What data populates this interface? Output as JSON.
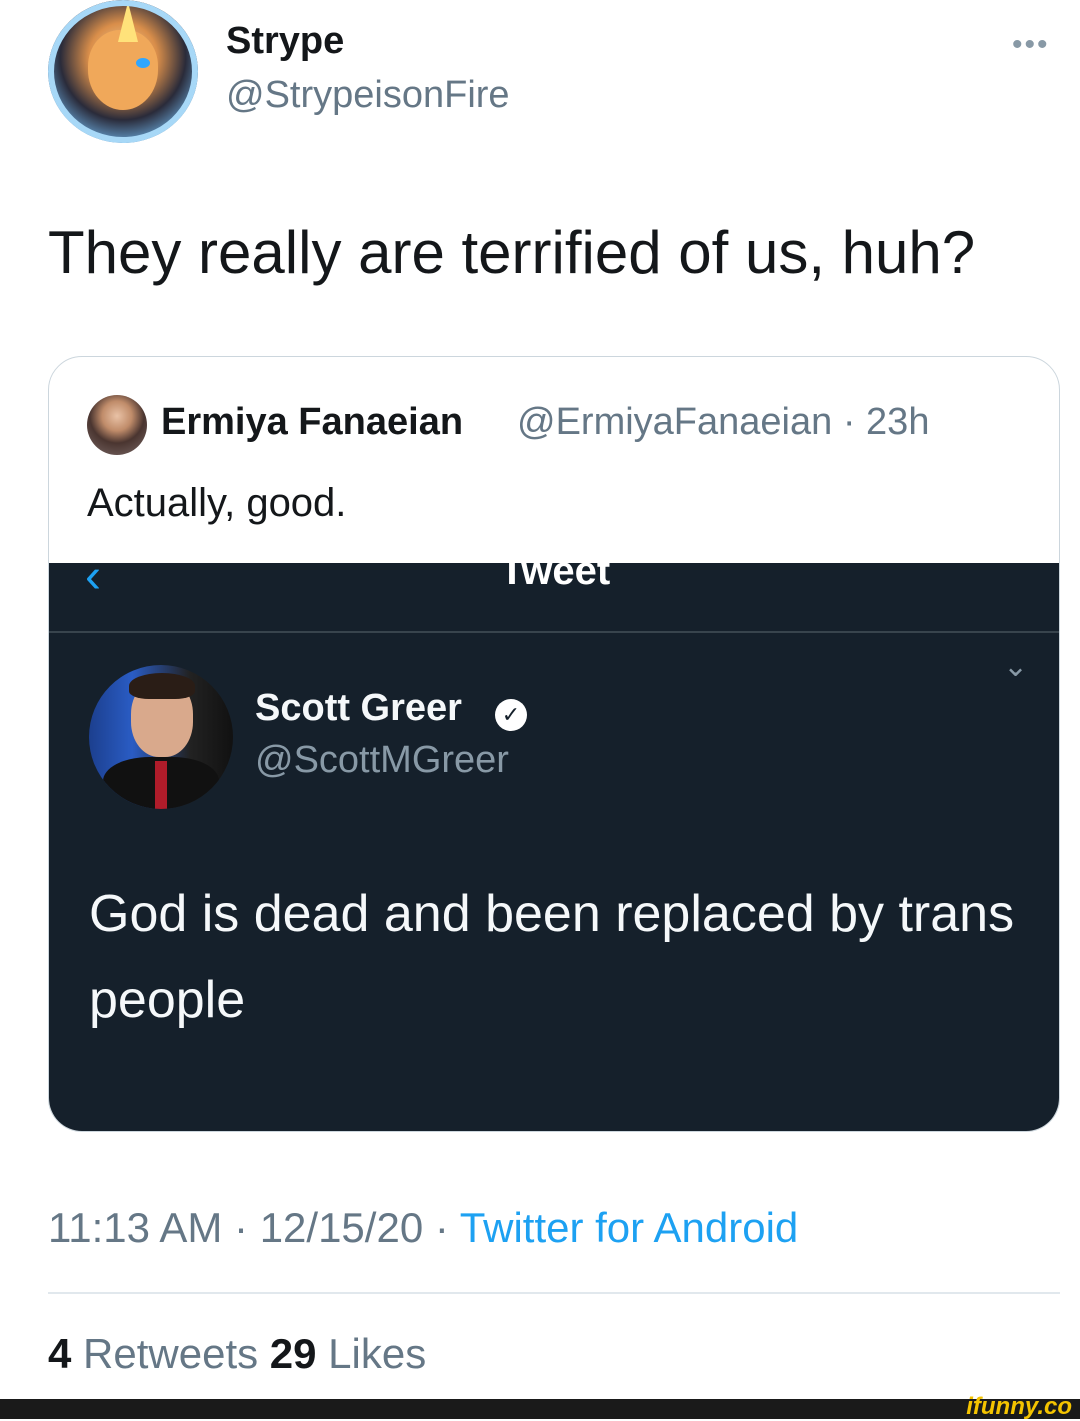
{
  "tweet": {
    "display_name": "Strype",
    "handle": "@StrypeisonFire",
    "text": "They really are terrified of us, huh?",
    "time": "11:13 AM",
    "date": "12/15/20",
    "source": "Twitter for Android",
    "separator": "·",
    "retweets_count": "4",
    "retweets_label": "Retweets",
    "likes_count": "29",
    "likes_label": "Likes",
    "more_icon": "more-options-icon"
  },
  "quoted": {
    "display_name": "Ermiya Fanaeian",
    "handle": "@ErmiyaFanaeian",
    "time": "23h",
    "separator": "·",
    "text": "Actually, good."
  },
  "embedded_screenshot": {
    "header_title": "Tweet",
    "back_icon": "back-chevron-icon",
    "expand_icon": "chevron-down-icon",
    "author_name": "Scott Greer",
    "author_handle": "@ScottMGreer",
    "verified_icon": "verified-badge-icon",
    "text": "God is dead and been replaced by trans people"
  },
  "watermark": "ifunny.co",
  "colors": {
    "link": "#1da1f2",
    "dark_bg": "#15202b",
    "secondary_text": "#657786"
  }
}
